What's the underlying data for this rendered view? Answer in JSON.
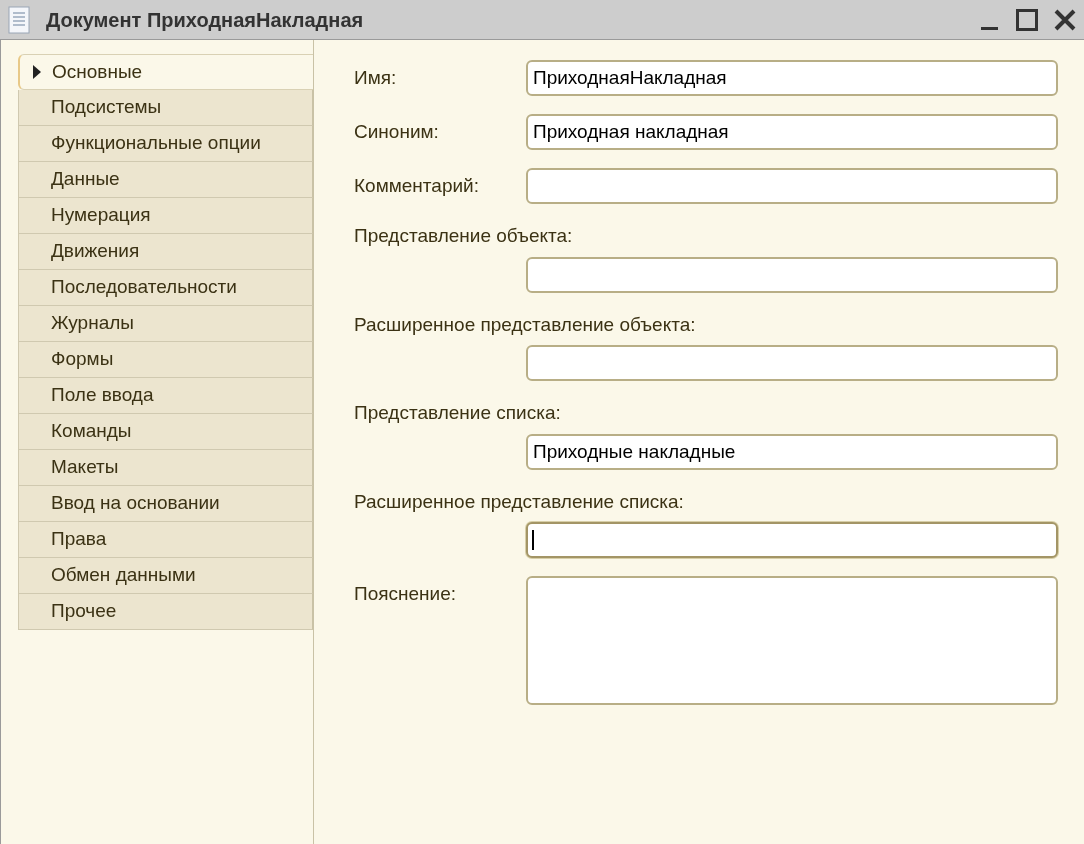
{
  "window": {
    "title": "Документ ПриходнаяНакладная"
  },
  "tabs": [
    {
      "label": "Основные",
      "selected": true
    },
    {
      "label": "Подсистемы",
      "selected": false
    },
    {
      "label": "Функциональные опции",
      "selected": false
    },
    {
      "label": "Данные",
      "selected": false
    },
    {
      "label": "Нумерация",
      "selected": false
    },
    {
      "label": "Движения",
      "selected": false
    },
    {
      "label": "Последовательности",
      "selected": false
    },
    {
      "label": "Журналы",
      "selected": false
    },
    {
      "label": "Формы",
      "selected": false
    },
    {
      "label": "Поле ввода",
      "selected": false
    },
    {
      "label": "Команды",
      "selected": false
    },
    {
      "label": "Макеты",
      "selected": false
    },
    {
      "label": "Ввод на основании",
      "selected": false
    },
    {
      "label": "Права",
      "selected": false
    },
    {
      "label": "Обмен данными",
      "selected": false
    },
    {
      "label": "Прочее",
      "selected": false
    }
  ],
  "fields": [
    {
      "kind": "inline",
      "label": "Имя:",
      "value": "ПриходнаяНакладная",
      "focused": false
    },
    {
      "kind": "inline",
      "label": "Синоним:",
      "value": "Приходная накладная",
      "focused": false
    },
    {
      "kind": "inline",
      "label": "Комментарий:",
      "focused": false
    },
    {
      "kind": "stacked",
      "label": "Представление объекта:",
      "focused": false
    },
    {
      "kind": "stacked",
      "label": "Расширенное представление объекта:",
      "focused": false
    },
    {
      "kind": "stacked",
      "label": "Представление списка:",
      "value": "Приходные накладные",
      "focused": false
    },
    {
      "kind": "stacked",
      "label": "Расширенное представление списка:",
      "focused": true
    },
    {
      "kind": "textarea",
      "label": "Пояснение:",
      "focused": false
    }
  ]
}
